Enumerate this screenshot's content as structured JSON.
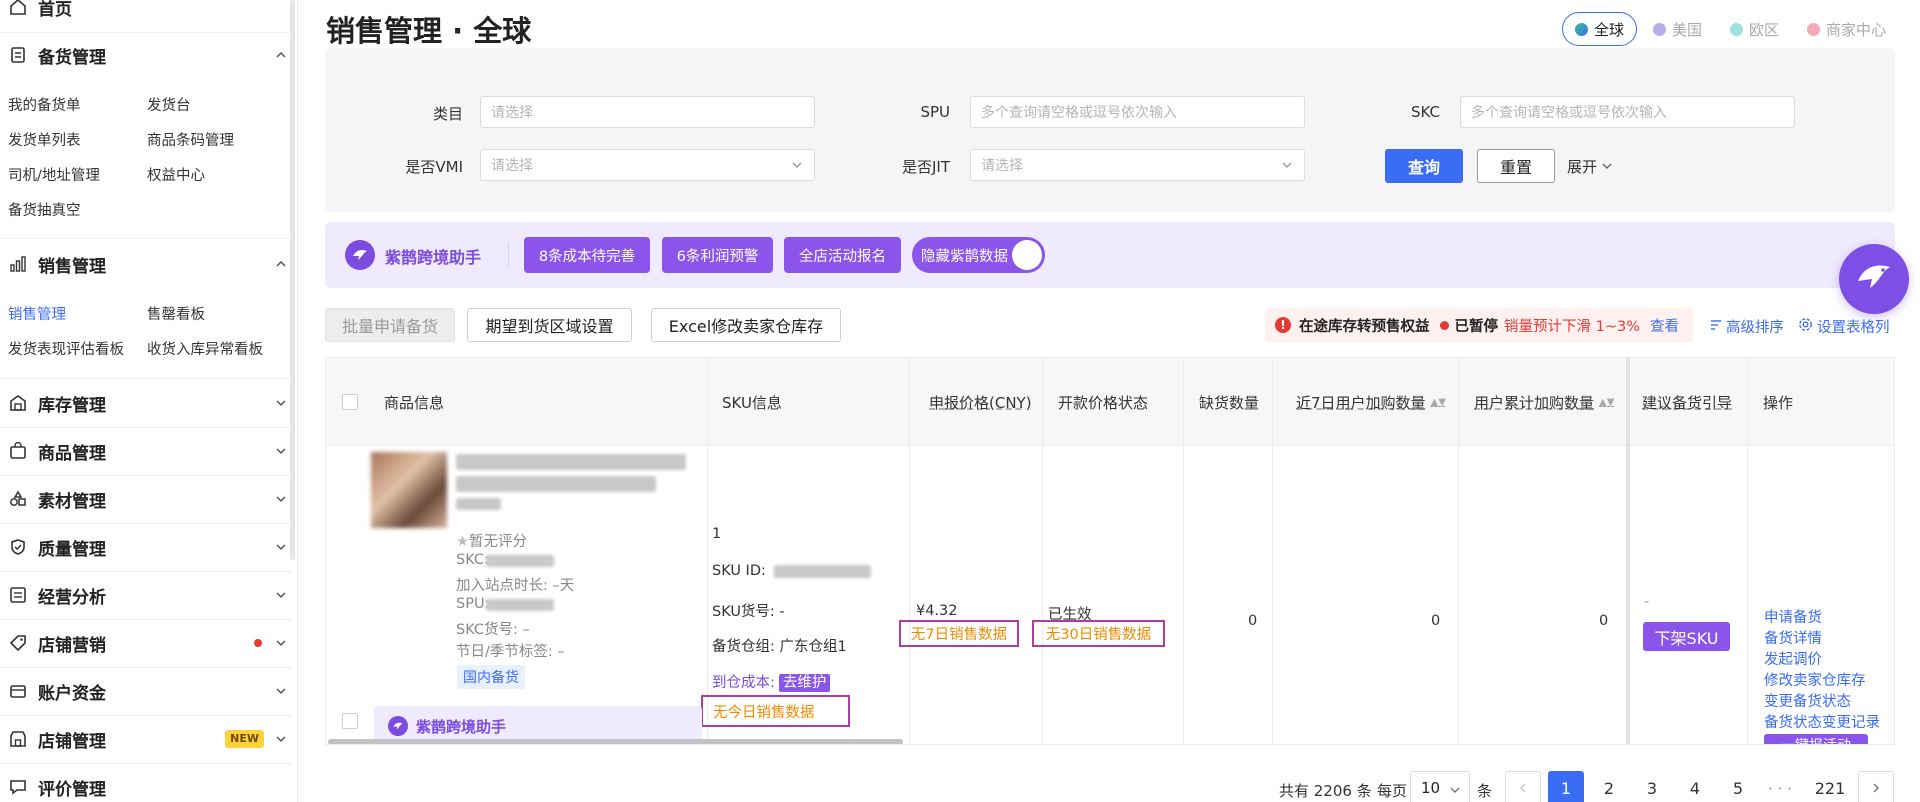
{
  "sidebar": {
    "home": "首页",
    "stock": {
      "title": "备货管理",
      "items": [
        "我的备货单",
        "发货台",
        "发货单列表",
        "商品条码管理",
        "司机/地址管理",
        "权益中心",
        "备货抽真空"
      ]
    },
    "sales": {
      "title": "销售管理",
      "items": [
        "销售管理",
        "售罄看板",
        "发货表现评估看板",
        "收货入库异常看板"
      ]
    },
    "groups": [
      "库存管理",
      "商品管理",
      "素材管理",
      "质量管理",
      "经营分析",
      "店铺营销",
      "账户资金",
      "店铺管理",
      "评价管理"
    ],
    "new_badge": "NEW"
  },
  "page": {
    "title": "销售管理 · 全球"
  },
  "regions": [
    "全球",
    "美国",
    "欧区",
    "商家中心"
  ],
  "filter": {
    "category_label": "类目",
    "category_placeholder": "请选择",
    "spu_label": "SPU",
    "spu_placeholder": "多个查询请空格或逗号依次输入",
    "skc_label": "SKC",
    "skc_placeholder": "多个查询请空格或逗号依次输入",
    "vmi_label": "是否VMI",
    "vmi_placeholder": "请选择",
    "jit_label": "是否JIT",
    "jit_placeholder": "请选择",
    "query_btn": "查询",
    "reset_btn": "重置",
    "expand": "展开"
  },
  "promo": {
    "brand": "紫鹊跨境助手",
    "buttons": [
      "8条成本待完善",
      "6条利润预警",
      "全店活动报名"
    ],
    "toggle_label": "隐藏紫鹊数据"
  },
  "toolbar": {
    "batch_apply": "批量申请备货",
    "region_setting": "期望到货区域设置",
    "excel_edit": "Excel修改卖家仓库存",
    "alert_title": "在途库存转预售权益",
    "alert_status": "已暂停",
    "alert_warn": "销量预计下滑 1~3%",
    "alert_view": "查看",
    "advanced_sort": "高级排序",
    "table_settings": "设置表格列"
  },
  "table": {
    "headers": [
      "商品信息",
      "SKU信息",
      "申报价格(CNY)",
      "开款价格状态",
      "缺货数量",
      "近7日用户加购数量",
      "用户累计加购数量",
      "建议备货引导",
      "操作"
    ],
    "row": {
      "rating": "暂无评分",
      "skc": "SKC:",
      "site_time": "加入站点时长: –天",
      "spu": "SPU:",
      "skc_no": "SKC货号: –",
      "season": "节日/季节标签: –",
      "domestic_tag": "国内备货",
      "sku_qty": "1",
      "sku_id": "SKU ID:",
      "sku_no": "SKU货号: -",
      "warehouse": "备货仓组: 广东仓组1",
      "arrival_cost_label": "到仓成本:",
      "arrival_cost_btn": "去维护",
      "no_today_sales": "无今日销售数据",
      "price": "¥4.32",
      "no_7d_sales": "无7日销售数据",
      "price_status": "已生效",
      "no_30d_sales": "无30日销售数据",
      "shortage": "0",
      "add7": "0",
      "add_total": "0",
      "suggest": "-",
      "offshelf": "下架SKU",
      "actions": [
        "申请备货",
        "备货详情",
        "发起调价",
        "修改卖家仓库存",
        "变更备货状态",
        "备货状态变更记录"
      ],
      "next_action": "一键报活动"
    },
    "row2_brand": "紫鹊跨境助手"
  },
  "pagination": {
    "total": "共有 2206 条",
    "per_page_label": "每页",
    "per_page": "10",
    "unit": "条",
    "pages": [
      "1",
      "2",
      "3",
      "4",
      "5"
    ],
    "ellipsis": "· · ·",
    "last": "221"
  },
  "colors": {
    "accent": "#3b6cf6",
    "purple": "#8b55ec",
    "warn": "#f08a00",
    "red": "#e53935"
  }
}
